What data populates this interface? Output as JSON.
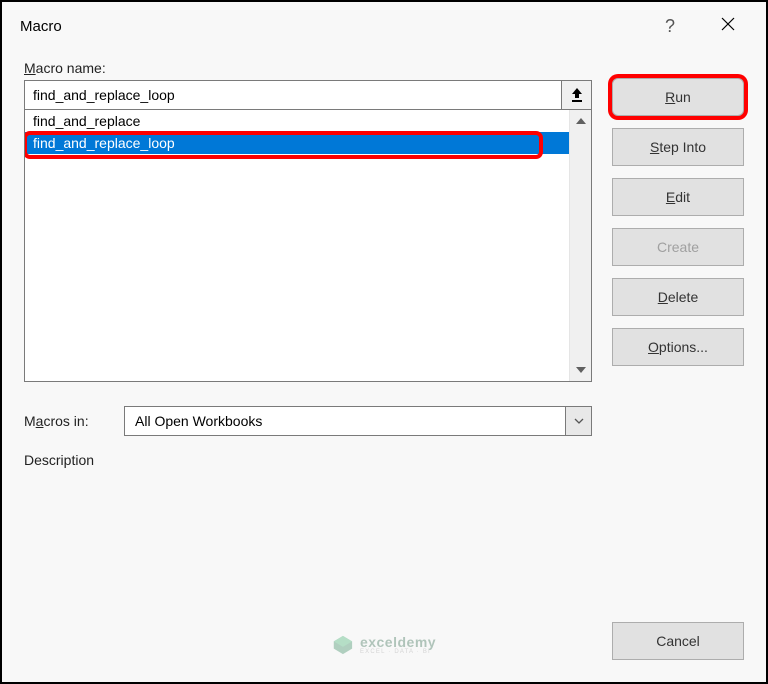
{
  "title": "Macro",
  "macro_name_label": "Macro name:",
  "macro_name_value": "find_and_replace_loop",
  "list_items": [
    {
      "label": "find_and_replace",
      "selected": false
    },
    {
      "label": "find_and_replace_loop",
      "selected": true
    }
  ],
  "macros_in_label": "Macros in:",
  "macros_in_value": "All Open Workbooks",
  "description_label": "Description",
  "buttons": {
    "run": "Run",
    "step_into": "Step Into",
    "edit": "Edit",
    "create": "Create",
    "delete": "Delete",
    "options": "Options...",
    "cancel": "Cancel"
  },
  "watermark": {
    "brand": "exceldemy",
    "tag": "EXCEL · DATA · BI"
  }
}
